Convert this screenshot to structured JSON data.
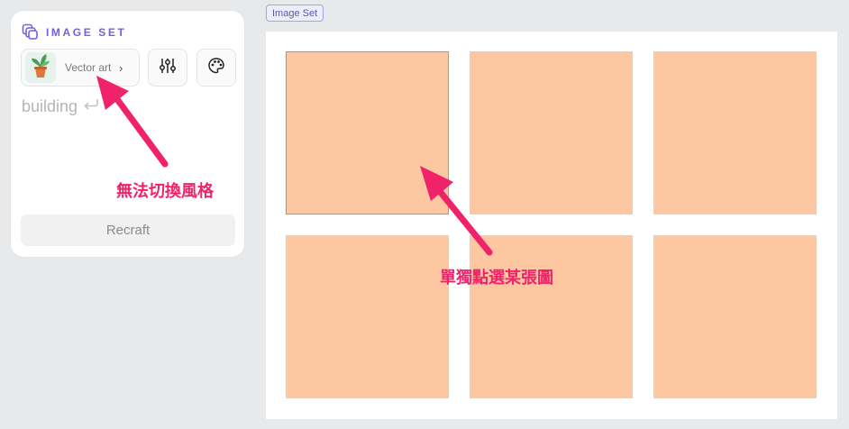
{
  "panel": {
    "title": "IMAGE SET",
    "style_button": {
      "label": "Vector art",
      "chevron": "›"
    },
    "tools": [
      {
        "icon": "sliders-icon"
      },
      {
        "icon": "palette-icon"
      }
    ],
    "prompt": {
      "text": "building",
      "icon": "enter-icon"
    },
    "action_button": "Recraft"
  },
  "canvas": {
    "tag": "Image Set",
    "tile_count": 6,
    "selected_index": 0
  },
  "annotations": [
    {
      "text": "無法切換風格"
    },
    {
      "text": "單獨點選某張圖"
    }
  ],
  "colors": {
    "accent": "#6f63d9",
    "tile": "#fdc8a1",
    "selection_border": "#e28a3b",
    "annotation": "#f0226a"
  }
}
